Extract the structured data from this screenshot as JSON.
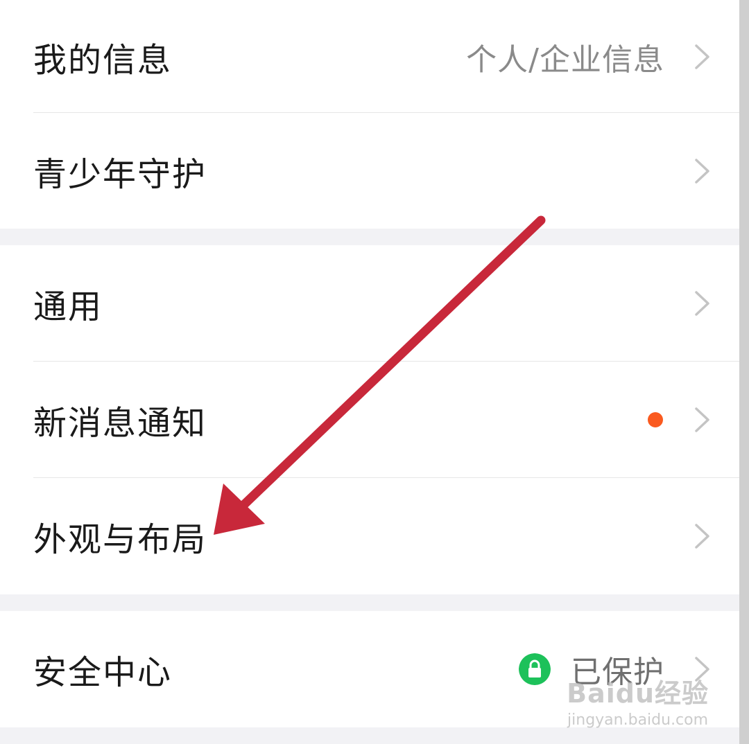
{
  "colors": {
    "background": "#f2f2f5",
    "row_background": "#ffffff",
    "title_text": "#1a1a1a",
    "secondary_text": "#8a8a8a",
    "chevron": "#c4c4c4",
    "notification_dot": "#fa5a1f",
    "protected_badge": "#1dc15a",
    "annotation_arrow": "#c8283a"
  },
  "settings": {
    "my_info": {
      "label": "我的信息",
      "value": "个人/企业信息",
      "icon": "chevron-right"
    },
    "youth_protection": {
      "label": "青少年守护",
      "icon": "chevron-right"
    },
    "general": {
      "label": "通用",
      "icon": "chevron-right"
    },
    "new_message_notification": {
      "label": "新消息通知",
      "has_new_dot": true,
      "icon": "chevron-right"
    },
    "appearance_layout": {
      "label": "外观与布局",
      "icon": "chevron-right"
    },
    "security_center": {
      "label": "安全中心",
      "status": "已保护",
      "status_icon": "lock-icon",
      "icon": "chevron-right"
    }
  },
  "watermark": {
    "logo": "Baidu经验",
    "url": "jingyan.baidu.com"
  },
  "annotation": {
    "type": "arrow",
    "points_to": "外观与布局"
  }
}
